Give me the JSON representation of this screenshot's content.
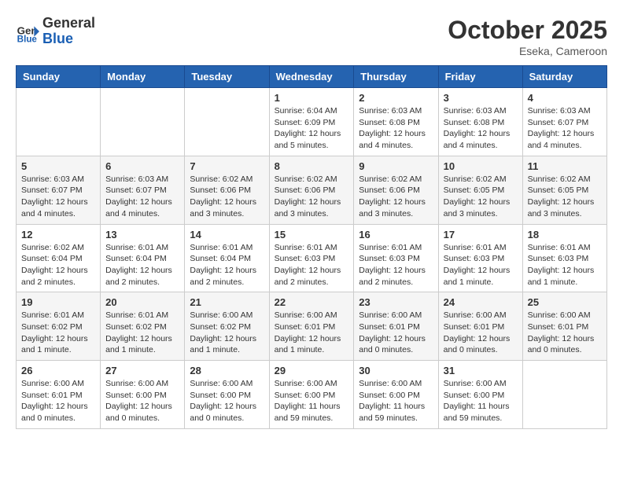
{
  "header": {
    "logo_text_top": "General",
    "logo_text_bottom": "Blue",
    "month": "October 2025",
    "location": "Eseka, Cameroon"
  },
  "days_of_week": [
    "Sunday",
    "Monday",
    "Tuesday",
    "Wednesday",
    "Thursday",
    "Friday",
    "Saturday"
  ],
  "weeks": [
    [
      {
        "day": "",
        "info": ""
      },
      {
        "day": "",
        "info": ""
      },
      {
        "day": "",
        "info": ""
      },
      {
        "day": "1",
        "info": "Sunrise: 6:04 AM\nSunset: 6:09 PM\nDaylight: 12 hours\nand 5 minutes."
      },
      {
        "day": "2",
        "info": "Sunrise: 6:03 AM\nSunset: 6:08 PM\nDaylight: 12 hours\nand 4 minutes."
      },
      {
        "day": "3",
        "info": "Sunrise: 6:03 AM\nSunset: 6:08 PM\nDaylight: 12 hours\nand 4 minutes."
      },
      {
        "day": "4",
        "info": "Sunrise: 6:03 AM\nSunset: 6:07 PM\nDaylight: 12 hours\nand 4 minutes."
      }
    ],
    [
      {
        "day": "5",
        "info": "Sunrise: 6:03 AM\nSunset: 6:07 PM\nDaylight: 12 hours\nand 4 minutes."
      },
      {
        "day": "6",
        "info": "Sunrise: 6:03 AM\nSunset: 6:07 PM\nDaylight: 12 hours\nand 4 minutes."
      },
      {
        "day": "7",
        "info": "Sunrise: 6:02 AM\nSunset: 6:06 PM\nDaylight: 12 hours\nand 3 minutes."
      },
      {
        "day": "8",
        "info": "Sunrise: 6:02 AM\nSunset: 6:06 PM\nDaylight: 12 hours\nand 3 minutes."
      },
      {
        "day": "9",
        "info": "Sunrise: 6:02 AM\nSunset: 6:06 PM\nDaylight: 12 hours\nand 3 minutes."
      },
      {
        "day": "10",
        "info": "Sunrise: 6:02 AM\nSunset: 6:05 PM\nDaylight: 12 hours\nand 3 minutes."
      },
      {
        "day": "11",
        "info": "Sunrise: 6:02 AM\nSunset: 6:05 PM\nDaylight: 12 hours\nand 3 minutes."
      }
    ],
    [
      {
        "day": "12",
        "info": "Sunrise: 6:02 AM\nSunset: 6:04 PM\nDaylight: 12 hours\nand 2 minutes."
      },
      {
        "day": "13",
        "info": "Sunrise: 6:01 AM\nSunset: 6:04 PM\nDaylight: 12 hours\nand 2 minutes."
      },
      {
        "day": "14",
        "info": "Sunrise: 6:01 AM\nSunset: 6:04 PM\nDaylight: 12 hours\nand 2 minutes."
      },
      {
        "day": "15",
        "info": "Sunrise: 6:01 AM\nSunset: 6:03 PM\nDaylight: 12 hours\nand 2 minutes."
      },
      {
        "day": "16",
        "info": "Sunrise: 6:01 AM\nSunset: 6:03 PM\nDaylight: 12 hours\nand 2 minutes."
      },
      {
        "day": "17",
        "info": "Sunrise: 6:01 AM\nSunset: 6:03 PM\nDaylight: 12 hours\nand 1 minute."
      },
      {
        "day": "18",
        "info": "Sunrise: 6:01 AM\nSunset: 6:03 PM\nDaylight: 12 hours\nand 1 minute."
      }
    ],
    [
      {
        "day": "19",
        "info": "Sunrise: 6:01 AM\nSunset: 6:02 PM\nDaylight: 12 hours\nand 1 minute."
      },
      {
        "day": "20",
        "info": "Sunrise: 6:01 AM\nSunset: 6:02 PM\nDaylight: 12 hours\nand 1 minute."
      },
      {
        "day": "21",
        "info": "Sunrise: 6:00 AM\nSunset: 6:02 PM\nDaylight: 12 hours\nand 1 minute."
      },
      {
        "day": "22",
        "info": "Sunrise: 6:00 AM\nSunset: 6:01 PM\nDaylight: 12 hours\nand 1 minute."
      },
      {
        "day": "23",
        "info": "Sunrise: 6:00 AM\nSunset: 6:01 PM\nDaylight: 12 hours\nand 0 minutes."
      },
      {
        "day": "24",
        "info": "Sunrise: 6:00 AM\nSunset: 6:01 PM\nDaylight: 12 hours\nand 0 minutes."
      },
      {
        "day": "25",
        "info": "Sunrise: 6:00 AM\nSunset: 6:01 PM\nDaylight: 12 hours\nand 0 minutes."
      }
    ],
    [
      {
        "day": "26",
        "info": "Sunrise: 6:00 AM\nSunset: 6:01 PM\nDaylight: 12 hours\nand 0 minutes."
      },
      {
        "day": "27",
        "info": "Sunrise: 6:00 AM\nSunset: 6:00 PM\nDaylight: 12 hours\nand 0 minutes."
      },
      {
        "day": "28",
        "info": "Sunrise: 6:00 AM\nSunset: 6:00 PM\nDaylight: 12 hours\nand 0 minutes."
      },
      {
        "day": "29",
        "info": "Sunrise: 6:00 AM\nSunset: 6:00 PM\nDaylight: 11 hours\nand 59 minutes."
      },
      {
        "day": "30",
        "info": "Sunrise: 6:00 AM\nSunset: 6:00 PM\nDaylight: 11 hours\nand 59 minutes."
      },
      {
        "day": "31",
        "info": "Sunrise: 6:00 AM\nSunset: 6:00 PM\nDaylight: 11 hours\nand 59 minutes."
      },
      {
        "day": "",
        "info": ""
      }
    ]
  ]
}
